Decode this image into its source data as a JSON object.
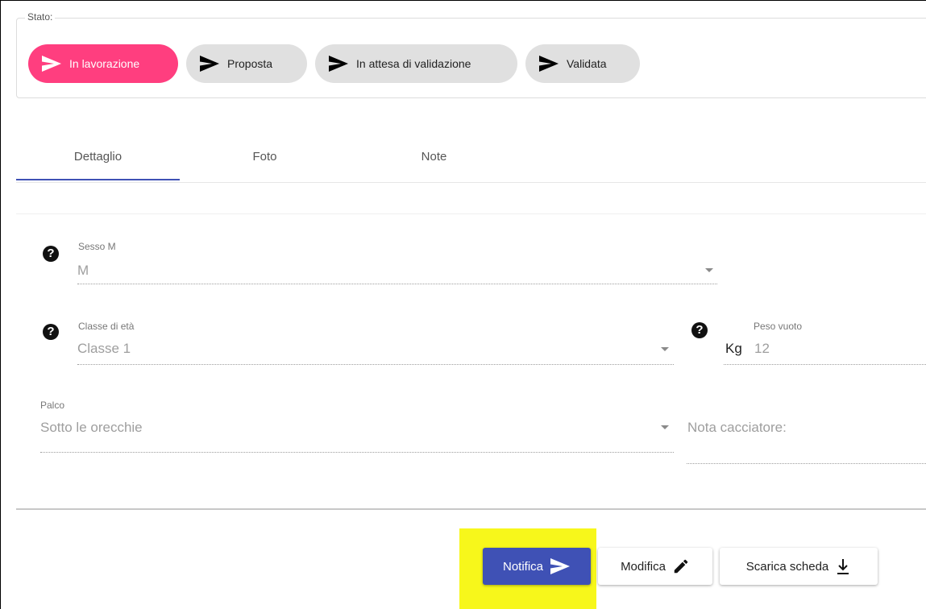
{
  "stato": {
    "legend": "Stato:",
    "chips": [
      {
        "label": "In lavorazione",
        "active": true
      },
      {
        "label": "Proposta",
        "active": false
      },
      {
        "label": "In attesa di validazione",
        "active": false
      },
      {
        "label": "Validata",
        "active": false
      }
    ]
  },
  "tabs": [
    {
      "label": "Dettaglio",
      "selected": true
    },
    {
      "label": "Foto",
      "selected": false
    },
    {
      "label": "Note",
      "selected": false
    }
  ],
  "form": {
    "sesso": {
      "label": "Sesso M",
      "value": "M"
    },
    "classe": {
      "label": "Classe di età",
      "value": "Classe 1"
    },
    "peso": {
      "label": "Peso vuoto",
      "unit": "Kg",
      "value": "12"
    },
    "palco": {
      "label": "Palco",
      "value": "Sotto le orecchie"
    },
    "nota": {
      "label": "Nota cacciatore:"
    }
  },
  "actions": {
    "notifica": "Notifica",
    "modifica": "Modifica",
    "scarica": "Scarica scheda"
  },
  "colors": {
    "accent_pink": "#ff3e7f",
    "primary_blue": "#3f51b5",
    "highlight_yellow": "#f7f71b"
  }
}
